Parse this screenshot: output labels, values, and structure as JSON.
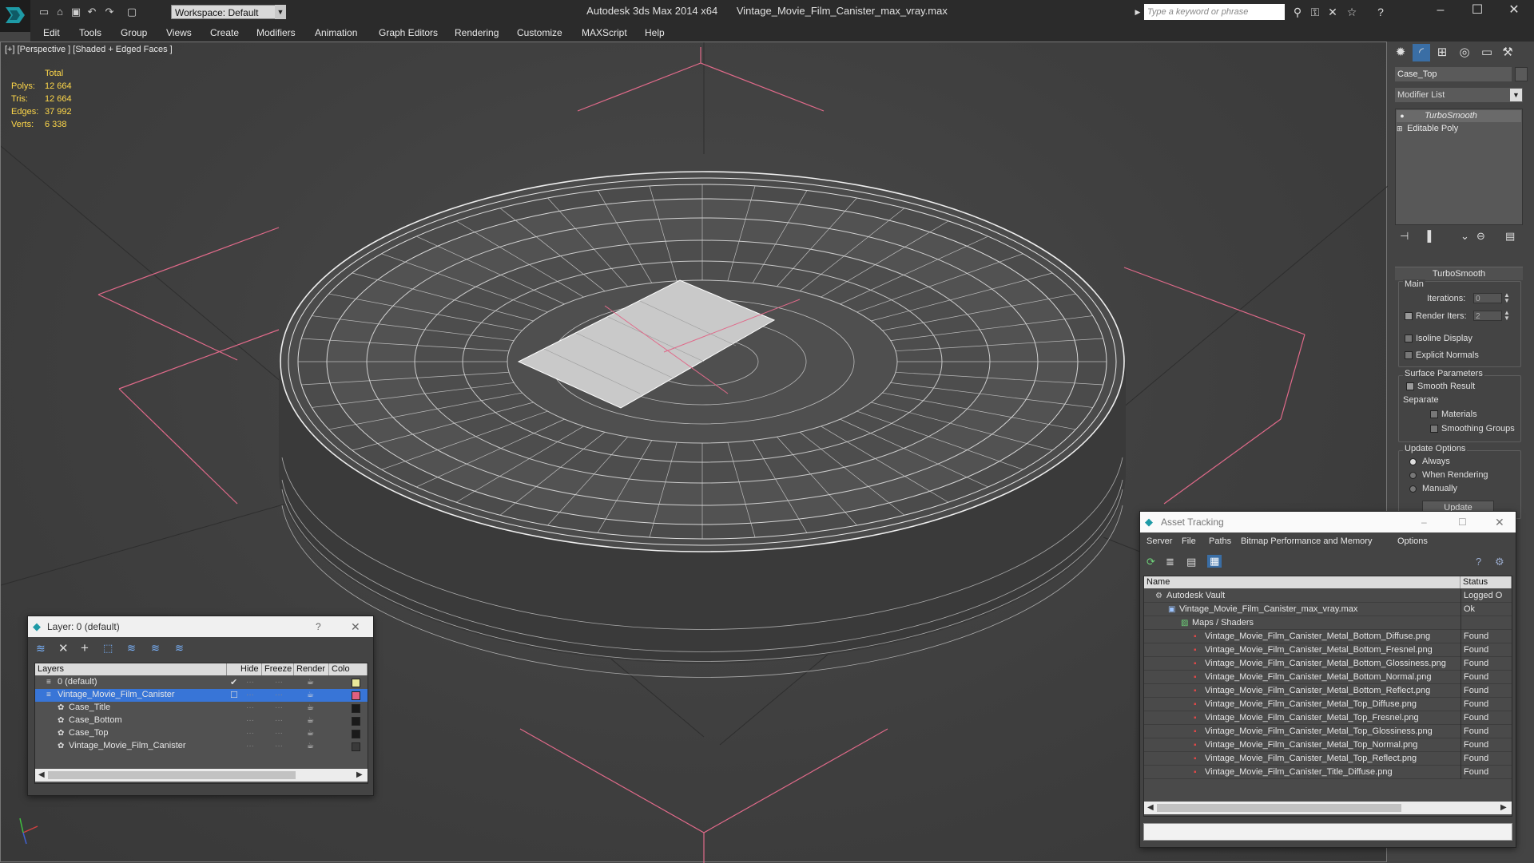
{
  "title_bar": {
    "workspace_label": "Workspace: Default",
    "app_name": "Autodesk 3ds Max  2014 x64",
    "file_name": "Vintage_Movie_Film_Canister_max_vray.max",
    "search_placeholder": "Type a keyword or phrase"
  },
  "menu": [
    "Edit",
    "Tools",
    "Group",
    "Views",
    "Create",
    "Modifiers",
    "Animation",
    "Graph Editors",
    "Rendering",
    "Customize",
    "MAXScript",
    "Help"
  ],
  "viewport": {
    "label": "[+] [Perspective ] [Shaded + Edged Faces ]",
    "stats": {
      "header": "Total",
      "rows": [
        {
          "label": "Polys:",
          "value": "12 664"
        },
        {
          "label": "Tris:",
          "value": "12 664"
        },
        {
          "label": "Edges:",
          "value": "37 992"
        },
        {
          "label": "Verts:",
          "value": "6 338"
        }
      ]
    }
  },
  "command_panel": {
    "object_name": "Case_Top",
    "modifier_list": "Modifier List",
    "stack": [
      "TurboSmooth",
      "Editable Poly"
    ],
    "turbosmooth": {
      "title": "TurboSmooth",
      "main": "Main",
      "iterations_label": "Iterations:",
      "iterations_value": "0",
      "render_iters_label": "Render Iters:",
      "render_iters_value": "2",
      "isoline": "Isoline Display",
      "explicit_normals": "Explicit Normals",
      "surface_params": "Surface Parameters",
      "smooth_result": "Smooth Result",
      "separate": "Separate",
      "materials": "Materials",
      "smoothing_groups": "Smoothing Groups",
      "update_options": "Update Options",
      "always": "Always",
      "when_rendering": "When Rendering",
      "manually": "Manually",
      "update_button": "Update"
    }
  },
  "layer_window": {
    "title": "Layer: 0 (default)",
    "help": "?",
    "columns": [
      "Layers",
      "Hide",
      "Freeze",
      "Render",
      "Colo"
    ],
    "rows": [
      {
        "name": "0 (default)",
        "indent": 1,
        "selected": false,
        "color": "#e8e89a",
        "active": true
      },
      {
        "name": "Vintage_Movie_Film_Canister",
        "indent": 1,
        "selected": true,
        "color": "#e06080",
        "active": false
      },
      {
        "name": "Case_Title",
        "indent": 2,
        "selected": false,
        "color": "#1a1a1a",
        "active": false
      },
      {
        "name": "Case_Bottom",
        "indent": 2,
        "selected": false,
        "color": "#1a1a1a",
        "active": false
      },
      {
        "name": "Case_Top",
        "indent": 2,
        "selected": false,
        "color": "#1a1a1a",
        "active": false
      },
      {
        "name": "Vintage_Movie_Film_Canister",
        "indent": 2,
        "selected": false,
        "color": "#3a3a3a",
        "active": false
      }
    ]
  },
  "asset_window": {
    "title": "Asset Tracking",
    "menu": [
      "Server",
      "File",
      "Paths",
      "Bitmap Performance and Memory",
      "Options"
    ],
    "columns": [
      "Name",
      "Status"
    ],
    "rows": [
      {
        "name": "Autodesk Vault",
        "indent": 1,
        "status": "Logged O"
      },
      {
        "name": "Vintage_Movie_Film_Canister_max_vray.max",
        "indent": 2,
        "status": "Ok"
      },
      {
        "name": "Maps / Shaders",
        "indent": 3,
        "status": ""
      },
      {
        "name": "Vintage_Movie_Film_Canister_Metal_Bottom_Diffuse.png",
        "indent": 4,
        "status": "Found"
      },
      {
        "name": "Vintage_Movie_Film_Canister_Metal_Bottom_Fresnel.png",
        "indent": 4,
        "status": "Found"
      },
      {
        "name": "Vintage_Movie_Film_Canister_Metal_Bottom_Glossiness.png",
        "indent": 4,
        "status": "Found"
      },
      {
        "name": "Vintage_Movie_Film_Canister_Metal_Bottom_Normal.png",
        "indent": 4,
        "status": "Found"
      },
      {
        "name": "Vintage_Movie_Film_Canister_Metal_Bottom_Reflect.png",
        "indent": 4,
        "status": "Found"
      },
      {
        "name": "Vintage_Movie_Film_Canister_Metal_Top_Diffuse.png",
        "indent": 4,
        "status": "Found"
      },
      {
        "name": "Vintage_Movie_Film_Canister_Metal_Top_Fresnel.png",
        "indent": 4,
        "status": "Found"
      },
      {
        "name": "Vintage_Movie_Film_Canister_Metal_Top_Glossiness.png",
        "indent": 4,
        "status": "Found"
      },
      {
        "name": "Vintage_Movie_Film_Canister_Metal_Top_Normal.png",
        "indent": 4,
        "status": "Found"
      },
      {
        "name": "Vintage_Movie_Film_Canister_Metal_Top_Reflect.png",
        "indent": 4,
        "status": "Found"
      },
      {
        "name": "Vintage_Movie_Film_Canister_Title_Diffuse.png",
        "indent": 4,
        "status": "Found"
      }
    ]
  },
  "colors": {
    "stats_yellow": "#ffd84a",
    "selection_blue": "#3875d7",
    "gizmo_pink": "#e06a8a"
  }
}
